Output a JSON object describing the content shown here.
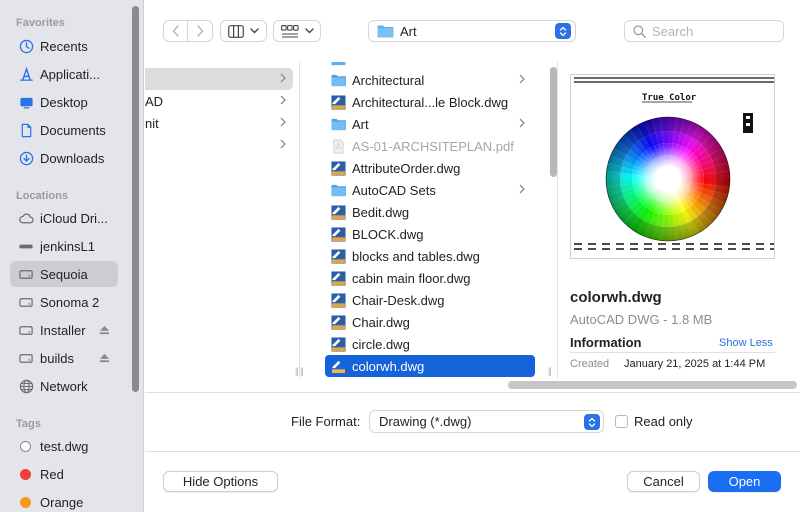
{
  "sidebar": {
    "favorites_header": "Favorites",
    "favorites": [
      {
        "label": "Recents",
        "icon": "clock-icon"
      },
      {
        "label": "Applicati...",
        "icon": "applications-icon"
      },
      {
        "label": "Desktop",
        "icon": "desktop-icon"
      },
      {
        "label": "Documents",
        "icon": "document-icon"
      },
      {
        "label": "Downloads",
        "icon": "download-icon"
      }
    ],
    "locations_header": "Locations",
    "locations": [
      {
        "label": "iCloud Dri...",
        "icon": "cloud-icon"
      },
      {
        "label": "jenkinsL1",
        "icon": "computer-icon"
      },
      {
        "label": "Sequoia",
        "icon": "disk-icon",
        "selected": true
      },
      {
        "label": "Sonoma 2",
        "icon": "disk-icon"
      },
      {
        "label": "Installer",
        "icon": "disk-icon",
        "eject": true
      },
      {
        "label": "builds",
        "icon": "disk-icon",
        "eject": true
      },
      {
        "label": "Network",
        "icon": "network-icon"
      }
    ],
    "tags_header": "Tags",
    "tags": [
      {
        "label": "test.dwg",
        "color": "#ffffff"
      },
      {
        "label": "Red",
        "color": "#ef4236"
      },
      {
        "label": "Orange",
        "color": "#f59a20"
      }
    ]
  },
  "toolbar": {
    "path": "Art",
    "search_placeholder": "Search"
  },
  "browser": {
    "column1": [
      {
        "label": "",
        "selected": true,
        "chevron": true
      },
      {
        "label": "AD",
        "chevron": true
      },
      {
        "label": "nit",
        "chevron": true
      },
      {
        "label": "",
        "chevron": true
      }
    ],
    "files": [
      {
        "label": "Architectural",
        "type": "folder",
        "chevron": true
      },
      {
        "label": "Architectural...le Block.dwg",
        "type": "dwg"
      },
      {
        "label": "Art",
        "type": "folder",
        "chevron": true
      },
      {
        "label": "AS-01-ARCHSITEPLAN.pdf",
        "type": "pdf",
        "dim": true
      },
      {
        "label": "AttributeOrder.dwg",
        "type": "dwg"
      },
      {
        "label": "AutoCAD Sets",
        "type": "folder",
        "chevron": true
      },
      {
        "label": "Bedit.dwg",
        "type": "dwg"
      },
      {
        "label": "BLOCK.dwg",
        "type": "dwg"
      },
      {
        "label": "blocks and tables.dwg",
        "type": "dwg"
      },
      {
        "label": "cabin main floor.dwg",
        "type": "dwg"
      },
      {
        "label": "Chair-Desk.dwg",
        "type": "dwg"
      },
      {
        "label": "Chair.dwg",
        "type": "dwg"
      },
      {
        "label": "circle.dwg",
        "type": "dwg"
      },
      {
        "label": "colorwh.dwg",
        "type": "dwg",
        "selected": true
      }
    ]
  },
  "preview": {
    "drawing_title": "True Color",
    "name": "colorwh.dwg",
    "kind": "AutoCAD DWG - 1.8 MB",
    "info_header": "Information",
    "show_less": "Show Less",
    "created_label": "Created",
    "created_value": "January 21, 2025 at 1:44 PM"
  },
  "options": {
    "file_format_label": "File Format:",
    "file_format_value": "Drawing (*.dwg)",
    "read_only_label": "Read only",
    "read_only_checked": false
  },
  "buttons": {
    "hide_options": "Hide Options",
    "cancel": "Cancel",
    "open": "Open"
  },
  "colors": {
    "accent": "#1a6ef2",
    "selection": "#1662d9",
    "folder": "#5fb0f0"
  }
}
